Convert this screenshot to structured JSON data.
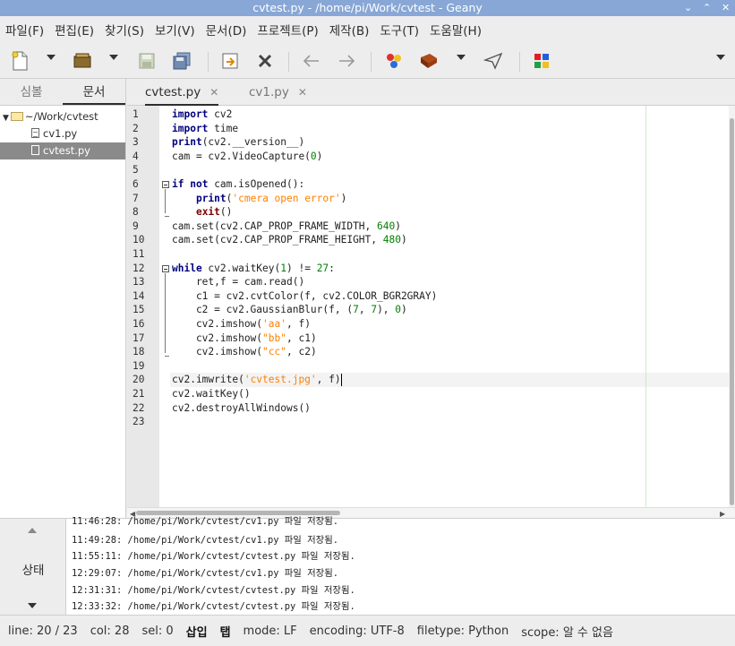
{
  "window": {
    "title": "cvtest.py - /home/pi/Work/cvtest - Geany",
    "controls": [
      "⌄",
      "⌃",
      "✕"
    ]
  },
  "menu": [
    "파일(F)",
    "편집(E)",
    "찾기(S)",
    "보기(V)",
    "문서(D)",
    "프로젝트(P)",
    "제작(B)",
    "도구(T)",
    "도움말(H)"
  ],
  "toolbar": {
    "icons": [
      "new-file-icon",
      "open-file-icon",
      "save-icon",
      "save-all-icon",
      "revert-icon",
      "close-icon",
      "back-icon",
      "forward-icon",
      "compile-icon",
      "build-icon",
      "execute-icon",
      "color-chooser-icon"
    ]
  },
  "sidebar": {
    "tabs": [
      "심볼",
      "문서"
    ],
    "active_tab": "문서",
    "folder": "~/Work/cvtest",
    "files": [
      "cv1.py",
      "cvtest.py"
    ],
    "selected_file": "cvtest.py"
  },
  "editor": {
    "tabs": [
      {
        "label": "cvtest.py",
        "active": true
      },
      {
        "label": "cv1.py",
        "active": false
      }
    ],
    "close_glyph": "✕",
    "current_line": 20,
    "lines": [
      "import cv2",
      "import time",
      "print(cv2.__version__)",
      "cam = cv2.VideoCapture(0)",
      "",
      "if not cam.isOpened():",
      "    print('cmera open error')",
      "    exit()",
      "cam.set(cv2.CAP_PROP_FRAME_WIDTH, 640)",
      "cam.set(cv2.CAP_PROP_FRAME_HEIGHT, 480)",
      "",
      "while cv2.waitKey(1) != 27:",
      "    ret,f = cam.read()",
      "    c1 = cv2.cvtColor(f, cv2.COLOR_BGR2GRAY)",
      "    c2 = cv2.GaussianBlur(f, (7, 7), 0)",
      "    cv2.imshow('aa', f)",
      "    cv2.imshow(\"bb\", c1)",
      "    cv2.imshow(\"cc\", c2)",
      "",
      "cv2.imwrite('cvtest.jpg', f)",
      "cv2.waitKey()",
      "cv2.destroyAllWindows()",
      ""
    ]
  },
  "messages": {
    "label": "상태",
    "items": [
      "11:46:28: /home/pi/Work/cvtest/cv1.py 파일 저장됨.",
      "11:49:28: /home/pi/Work/cvtest/cv1.py 파일 저장됨.",
      "11:55:11: /home/pi/Work/cvtest/cvtest.py 파일 저장됨.",
      "12:29:07: /home/pi/Work/cvtest/cv1.py 파일 저장됨.",
      "12:31:31: /home/pi/Work/cvtest/cvtest.py 파일 저장됨.",
      "12:33:32: /home/pi/Work/cvtest/cvtest.py 파일 저장됨."
    ]
  },
  "status": {
    "line": "line: 20 / 23",
    "col": "col: 28",
    "sel": "sel: 0",
    "insert": "삽입",
    "tab": "탭",
    "mode": "mode: LF",
    "encoding": "encoding: UTF-8",
    "filetype": "filetype: Python",
    "scope": "scope: 알 수 없음"
  },
  "colors": {
    "titlebar": "#88a7d6",
    "keyword": "#00007f",
    "string": "#ff8000",
    "number": "#007f00"
  }
}
